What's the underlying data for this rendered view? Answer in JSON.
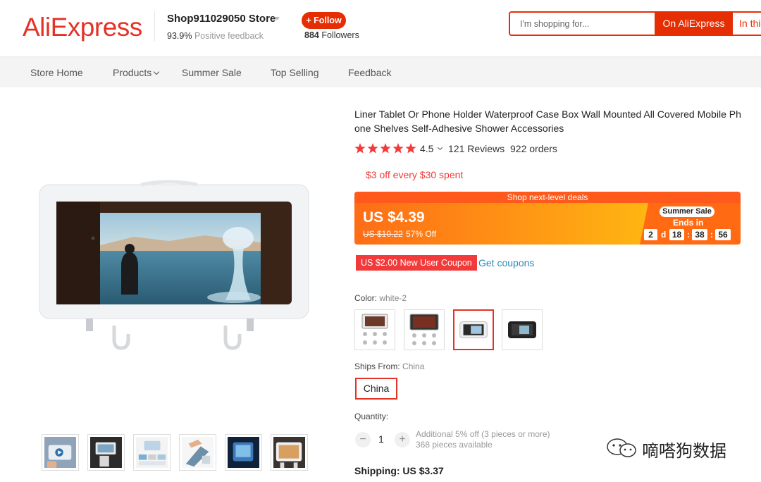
{
  "header": {
    "logo": "AliExpress",
    "store_name": "Shop911029050 Store",
    "feedback_pct": "93.9%",
    "feedback_label": "Positive feedback",
    "follow_label": "+ Follow",
    "followers_count": "884",
    "followers_label": "Followers",
    "search_placeholder": "I'm shopping for...",
    "search_btn_ali": "On AliExpress",
    "search_btn_store": "In this store"
  },
  "nav": {
    "items": [
      "Store Home",
      "Products",
      "Summer Sale",
      "Top Selling",
      "Feedback"
    ]
  },
  "product": {
    "title": "Liner Tablet Or Phone Holder Waterproof Case Box Wall Mounted All Covered Mobile Phone Shelves Self-Adhesive Shower Accessories",
    "rating": "4.5",
    "rating_stars": 5,
    "reviews": "121 Reviews",
    "orders": "922 orders",
    "promo": "$3 off every $30 spent",
    "deal": {
      "banner": "Shop next-level deals",
      "price": "US $4.39",
      "original_price": "US $10.22",
      "discount": "57% Off",
      "sale_badge": "Summer Sale",
      "ends_in": "Ends in",
      "countdown": {
        "days": "2",
        "day_unit": "d",
        "hours": "18",
        "minutes": "38",
        "seconds": "56"
      }
    },
    "coupon": "US $2.00 New User Coupon",
    "get_coupons": "Get coupons",
    "color_label": "Color:",
    "color_value": "white-2",
    "ships_from_label": "Ships From:",
    "ships_from_value": "China",
    "ships_option": "China",
    "quantity_label": "Quantity:",
    "quantity_value": "1",
    "qty_note_1": "Additional 5% off (3 pieces or more)",
    "qty_note_2": "368 pieces available",
    "shipping": "Shipping: US $3.37"
  },
  "watermark": "嘀嗒狗数据",
  "colors": {
    "brand": "#e43225",
    "accent": "#e62e04",
    "link": "#2a8ab8"
  }
}
